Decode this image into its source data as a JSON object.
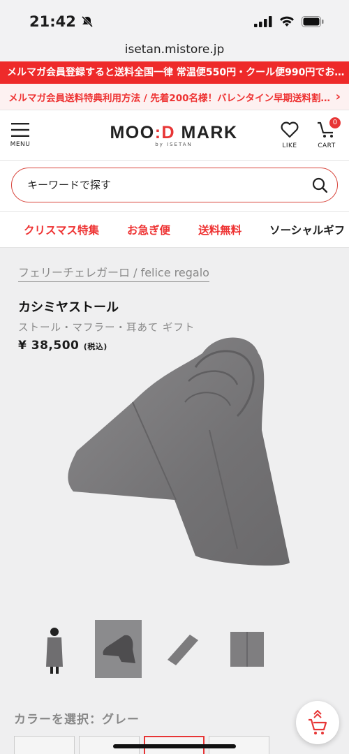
{
  "status": {
    "time": "21:42"
  },
  "browser": {
    "url": "isetan.mistore.jp"
  },
  "promo": {
    "red_text": "メルマガ会員登録すると送料全国一律 常温便550円・クール便990円でお…",
    "pink_text": "メルマガ会員送料特典利用方法 / 先着200名様！バレンタイン早期送料割…"
  },
  "header": {
    "menu_label": "MENU",
    "logo_left": "MOO",
    "logo_mark": ":D",
    "logo_right": " MARK",
    "logo_sub": "by ISETAN",
    "like_label": "LIKE",
    "cart_label": "CART",
    "cart_count": "0"
  },
  "search": {
    "placeholder": "キーワードで探す"
  },
  "categories": [
    "クリスマス特集",
    "お急ぎ便",
    "送料無料",
    "ソーシャルギフ"
  ],
  "product": {
    "brand": "フェリーチェレガーロ / felice regalo",
    "name": "カシミヤストール",
    "category": "ストール・マフラー・耳あて ギフト",
    "price": "¥ 38,500",
    "tax_note": "(税込)"
  },
  "color": {
    "label": "カラーを選択：グレー"
  },
  "icons": {
    "menu": "hamburger-icon",
    "like": "heart-icon",
    "cart": "cart-icon",
    "search": "search-icon"
  },
  "colors": {
    "accent": "#e73535",
    "product_gray": "#7a797b"
  }
}
